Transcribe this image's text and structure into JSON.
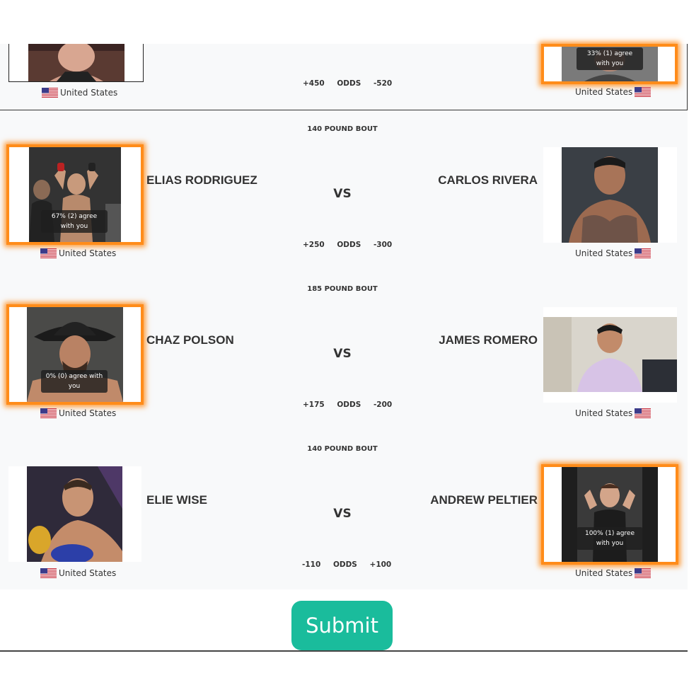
{
  "odds_label": "ODDS",
  "vs_label": "VS",
  "submit_label": "Submit",
  "partial_bout": {
    "left": {
      "country": "United States"
    },
    "right": {
      "country": "United States",
      "agree": "33% (1) agree with you"
    },
    "left_odds": "+450",
    "right_odds": "-520"
  },
  "bouts": [
    {
      "weight_class": "140 POUND BOUT",
      "left": {
        "name": "ELIAS RODRIGUEZ",
        "country": "United States",
        "agree": "67% (2) agree with you",
        "selected": true
      },
      "right": {
        "name": "CARLOS RIVERA",
        "country": "United States",
        "selected": false
      },
      "left_odds": "+250",
      "right_odds": "-300"
    },
    {
      "weight_class": "185 POUND BOUT",
      "left": {
        "name": "CHAZ POLSON",
        "country": "United States",
        "agree": "0% (0) agree with you",
        "selected": true
      },
      "right": {
        "name": "JAMES ROMERO",
        "country": "United States",
        "selected": false
      },
      "left_odds": "+175",
      "right_odds": "-200"
    },
    {
      "weight_class": "140 POUND BOUT",
      "left": {
        "name": "ELIE WISE",
        "country": "United States",
        "selected": false
      },
      "right": {
        "name": "ANDREW PELTIER",
        "country": "United States",
        "agree": "100% (1) agree with you",
        "selected": true
      },
      "left_odds": "-110",
      "right_odds": "+100"
    }
  ],
  "icons": {
    "flag": "us-flag-icon"
  },
  "colors": {
    "selected_glow": "#ff8c1a",
    "submit": "#1abc9c",
    "panel_bg": "#f8f9fa"
  }
}
